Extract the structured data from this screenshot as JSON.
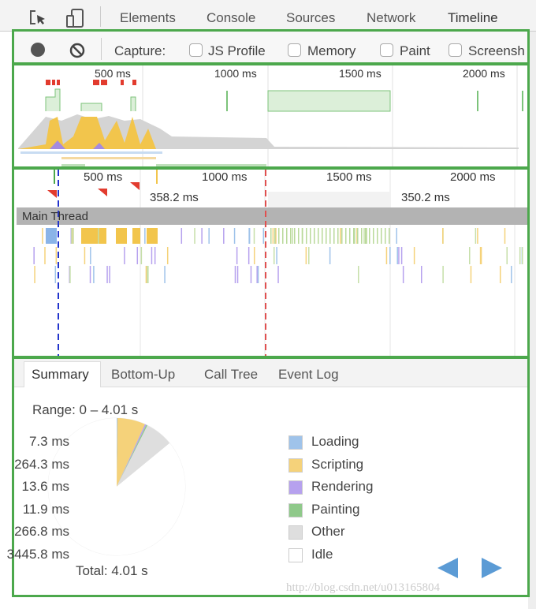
{
  "tabs": [
    {
      "label": "Elements"
    },
    {
      "label": "Console"
    },
    {
      "label": "Sources"
    },
    {
      "label": "Network"
    },
    {
      "label": "Timeline",
      "active": true
    }
  ],
  "toolbar": {
    "capture_label": "Capture:",
    "options": [
      {
        "label": "JS Profile",
        "checked": false
      },
      {
        "label": "Memory",
        "checked": false
      },
      {
        "label": "Paint",
        "checked": false
      },
      {
        "label": "Screensh",
        "checked": false
      }
    ]
  },
  "overview": {
    "ticks": [
      "500 ms",
      "1000 ms",
      "1500 ms",
      "2000 ms"
    ]
  },
  "flame": {
    "ticks": [
      "500 ms",
      "1000 ms",
      "1500 ms",
      "2000 ms"
    ],
    "frames": [
      "358.2 ms",
      "350.2 ms"
    ],
    "main_thread": "Main Thread"
  },
  "summary": {
    "tabs": [
      "Summary",
      "Bottom-Up",
      "Call Tree",
      "Event Log"
    ],
    "range": "Range: 0 – 4.01 s",
    "total": "Total: 4.01 s",
    "categories": [
      {
        "value": "7.3 ms",
        "ms": 7.3,
        "label": "Loading",
        "color": "#9fc3ea"
      },
      {
        "value": "264.3 ms",
        "ms": 264.3,
        "label": "Scripting",
        "color": "#f5d27a"
      },
      {
        "value": "13.6 ms",
        "ms": 13.6,
        "label": "Rendering",
        "color": "#b6a1ee"
      },
      {
        "value": "11.9 ms",
        "ms": 11.9,
        "label": "Painting",
        "color": "#8fc98a"
      },
      {
        "value": "266.8 ms",
        "ms": 266.8,
        "label": "Other",
        "color": "#dedede"
      },
      {
        "value": "3445.8 ms",
        "ms": 3445.8,
        "label": "Idle",
        "color": "#ffffff"
      }
    ]
  },
  "colors": {
    "accent_border": "#4ca84c",
    "nav_arrow": "#5b9bd5"
  },
  "watermark": "http://blog.csdn.net/u013165804"
}
